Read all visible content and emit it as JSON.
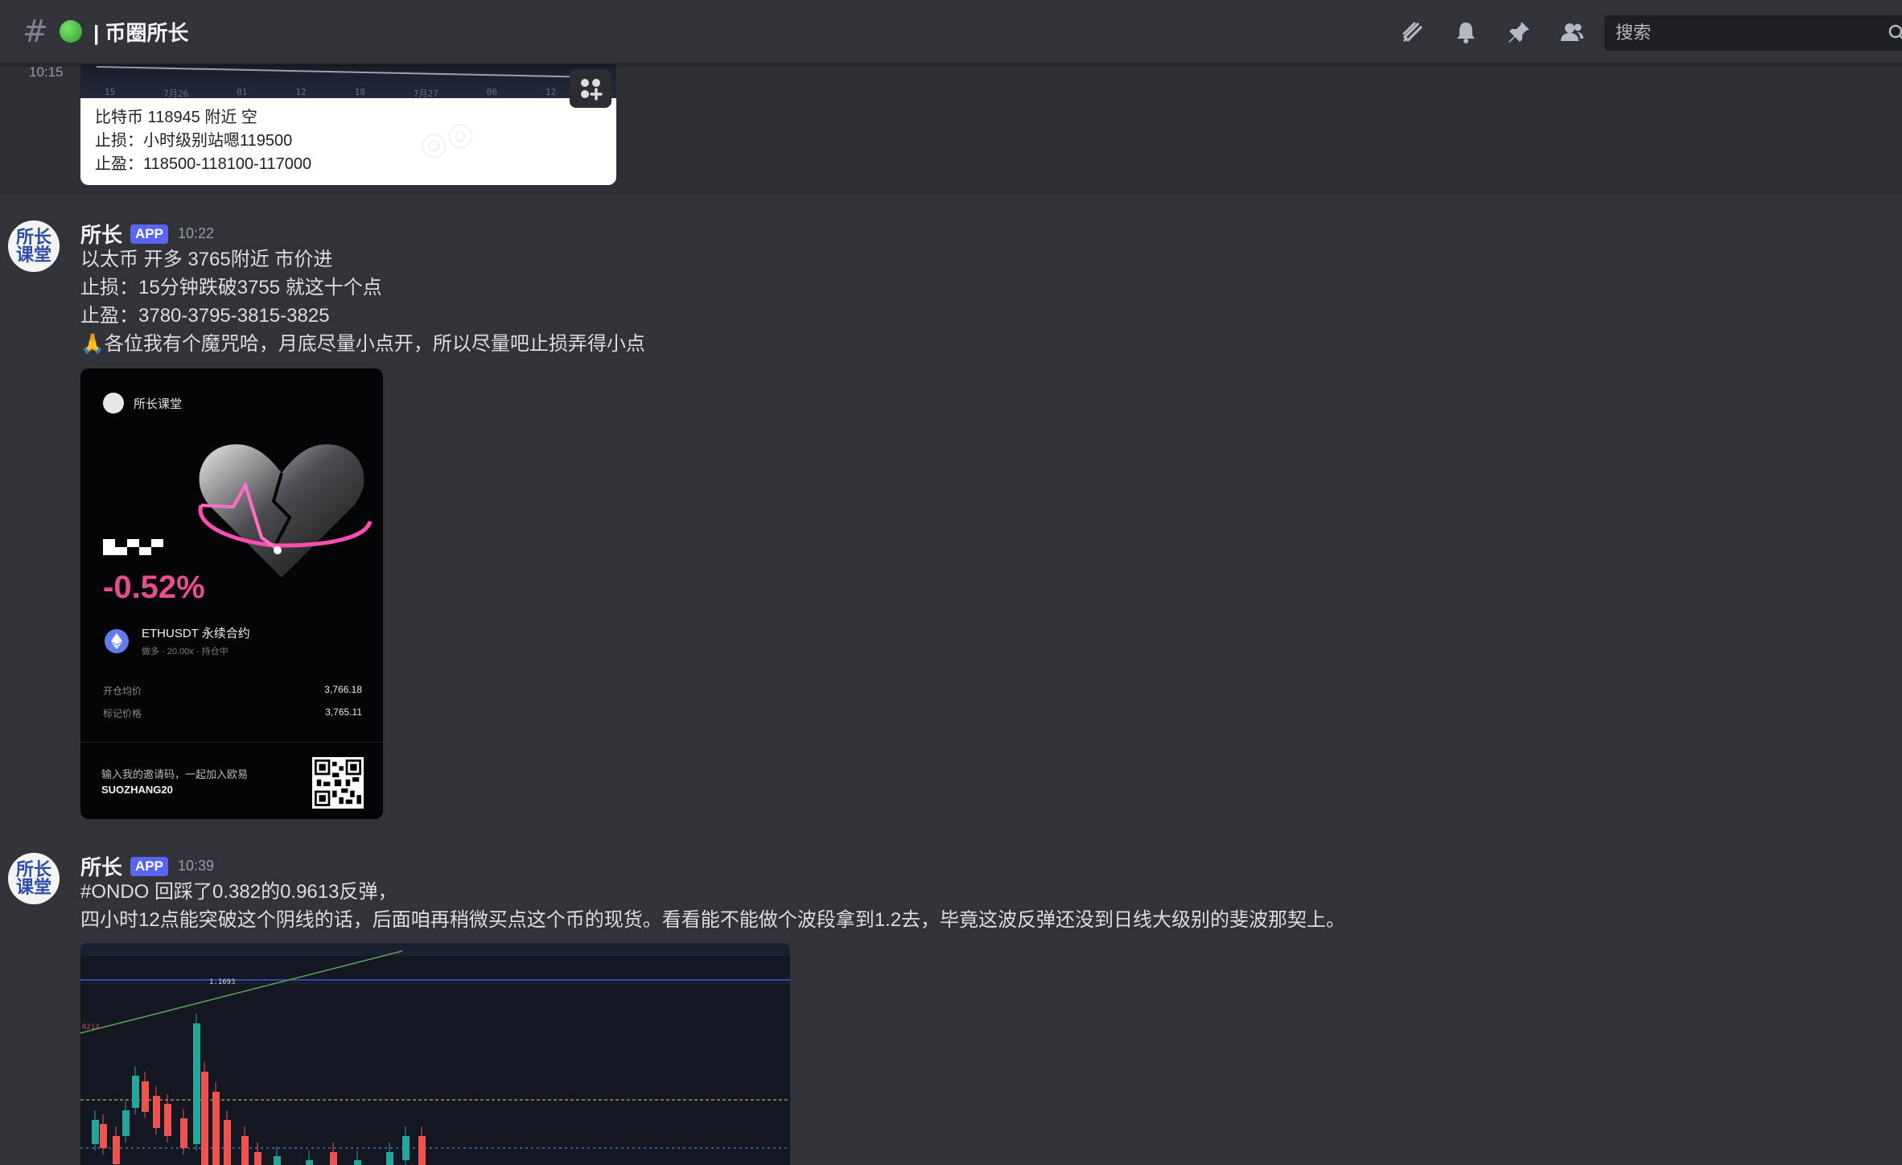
{
  "header": {
    "channel_name": "币圈所长",
    "search_placeholder": "搜索",
    "icons": [
      "threads-icon",
      "bell-icon",
      "pin-icon",
      "members-icon",
      "search-icon"
    ]
  },
  "previous_message": {
    "time": "10:15",
    "image_lines": [
      "比特币 118945 附近 空",
      "止损：小时级别站嗯119500",
      "止盈：118500-118100-117000"
    ],
    "chart_strip_labels": [
      "15",
      "7月26",
      "01",
      "12",
      "18",
      "7月27",
      "06",
      "12"
    ]
  },
  "messages": [
    {
      "author": "所长",
      "badge": "APP",
      "time": "10:22",
      "lines": [
        "以太币 开多 3765附近 市价进",
        "止损：15分钟跌破3755 就这十个点",
        "止盈：3780-3795-3815-3825",
        "🙏各位我有个魔咒哈，月底尽量小点开，所以尽量吧止损弄得小点"
      ],
      "card": {
        "brand": "所长课堂",
        "percent": "-0.52%",
        "pair": "ETHUSDT 永续合约",
        "pair_sub": "做多 · 20.00x · 持仓中",
        "open_label": "开仓均价",
        "open_value": "3,766.18",
        "mark_label": "标记价格",
        "mark_value": "3,765.11",
        "invite_text": "输入我的邀请码，一起加入欧易",
        "invite_code": "SUOZHANG20",
        "accent_color": "#e84e8e"
      }
    },
    {
      "author": "所长",
      "badge": "APP",
      "time": "10:39",
      "lines": [
        "#ONDO 回踩了0.382的0.9613反弹，",
        "四小时12点能突破这个阴线的话，后面咱再稍微买点这个币的现货。看看能不能做个波段拿到1.2去，毕竟这波反弹还没到日线大级别的斐波那契上。"
      ],
      "chart_labels": {
        "peak": "1.1693",
        "left_axis": "0214"
      }
    }
  ],
  "avatar_text": [
    "所长",
    "课堂"
  ],
  "colors": {
    "background": "#313338",
    "badge": "#5865f2",
    "candle_up": "#26a69a",
    "candle_down": "#ef5350"
  }
}
